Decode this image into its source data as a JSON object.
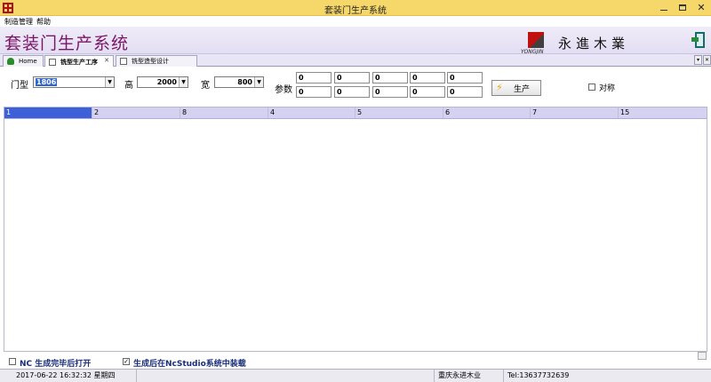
{
  "window": {
    "title": "套装门生产系统"
  },
  "menu": [
    "制造管理",
    "帮助"
  ],
  "banner": {
    "app_title": "套装门生产系统",
    "logo_text": "永進木業",
    "logo_en": "YONGJIN"
  },
  "tabs": [
    {
      "label": "Home",
      "active": false
    },
    {
      "label": "铣型生产工序",
      "active": true,
      "close": "✕"
    },
    {
      "label": "铣型造型设计",
      "active": false
    }
  ],
  "form": {
    "door_type_label": "门型",
    "door_type_value": "1806",
    "height_label": "高",
    "height_value": "2000",
    "width_label": "宽",
    "width_value": "800",
    "params_label": "参数",
    "params": [
      [
        "0",
        "0",
        "0",
        "0",
        "0"
      ],
      [
        "0",
        "0",
        "0",
        "0",
        "0"
      ]
    ],
    "produce_button": "生产",
    "symmetric_label": "对称",
    "symmetric_checked": false
  },
  "grid": {
    "headers": [
      "1",
      "2",
      "8",
      "4",
      "5",
      "6",
      "7",
      "15"
    ]
  },
  "options": {
    "open_after_nc": "NC 生成完毕后打开",
    "open_after_nc_checked": false,
    "load_in_ncstudio": "生成后在NcStudio系统中装载",
    "load_in_ncstudio_checked": true,
    "check_mark": "✓"
  },
  "status": {
    "datetime": "2017-06-22 16:32:32 星期四",
    "company": "重庆永进木业",
    "tel": "Tel:13637732639"
  },
  "colors": {
    "title_bar": "#f5d76a",
    "banner_title": "#7a1565",
    "grid_header": "#d4d2f0",
    "selected_cell": "#3d5fd8"
  }
}
